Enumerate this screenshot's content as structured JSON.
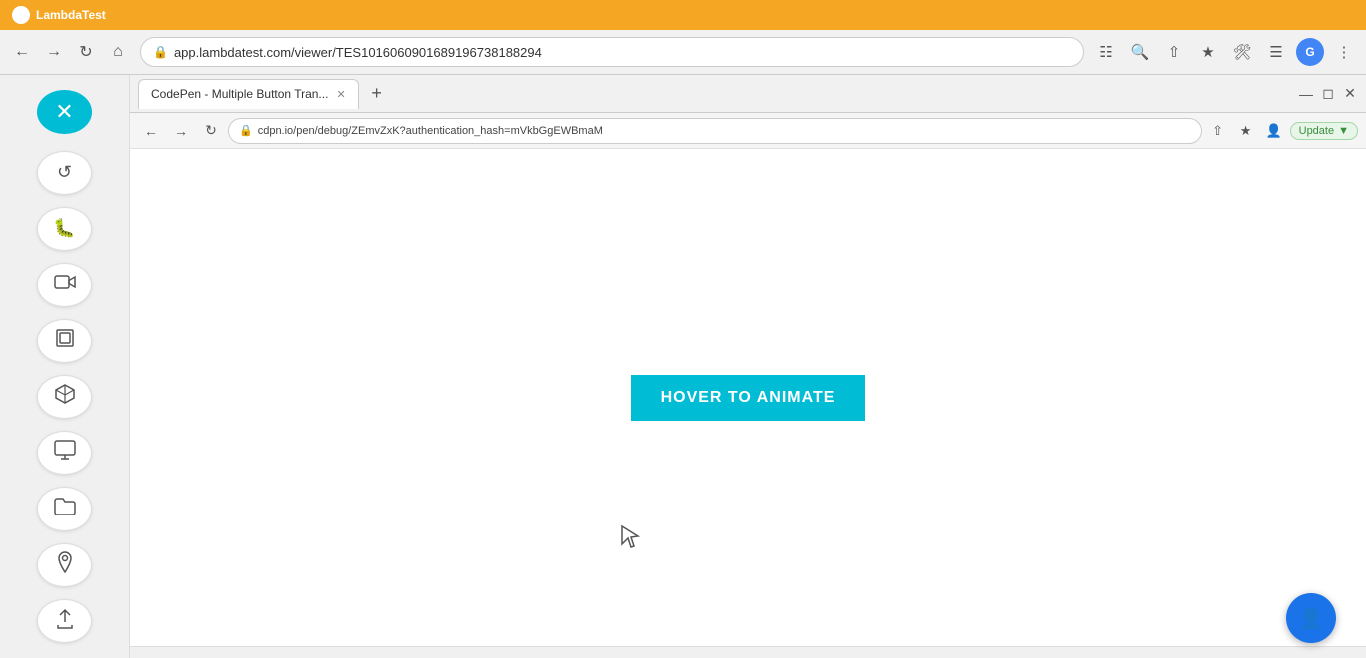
{
  "lambdatest_bar": {
    "logo_text": "LambdaTest"
  },
  "chrome_bar": {
    "address": "app.lambdatest.com/viewer/TES101606090168919673818829 4",
    "address_short": "app.lambdatest.com/viewer/TES1016060901689196738188294"
  },
  "inner_browser": {
    "tab_title": "CodePen - Multiple Button Tran...",
    "address": "cdpn.io/pen/debug/ZEmvZxK?authentication_hash=mVkbGgEWBmaM",
    "update_label": "Update",
    "new_tab_symbol": "+"
  },
  "sidebar": {
    "close_icon": "✕",
    "icons": [
      {
        "name": "refresh-icon",
        "symbol": "↺"
      },
      {
        "name": "bug-icon",
        "symbol": "🐛"
      },
      {
        "name": "video-icon",
        "symbol": "▶"
      },
      {
        "name": "layers-icon",
        "symbol": "⊟"
      },
      {
        "name": "cube-icon",
        "symbol": "⬡"
      },
      {
        "name": "monitor-icon",
        "symbol": "🖥"
      },
      {
        "name": "folder-icon",
        "symbol": "🗀"
      },
      {
        "name": "location-icon",
        "symbol": "⊙"
      },
      {
        "name": "share-icon",
        "symbol": "↑"
      }
    ]
  },
  "content": {
    "hover_button_label": "HOVER TO ANIMATE"
  },
  "colors": {
    "teal": "#00bcd4",
    "orange": "#f5a623",
    "update_green": "#388e3c"
  }
}
